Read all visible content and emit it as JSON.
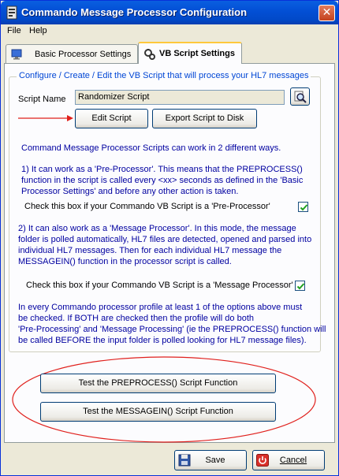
{
  "window": {
    "title": "Commando Message Processor Configuration",
    "close_glyph": "✕"
  },
  "menu": {
    "items": [
      "File",
      "Help"
    ]
  },
  "tabs": [
    {
      "label": "Basic Processor Settings",
      "icon": "monitor-icon",
      "active": false
    },
    {
      "label": "VB Script Settings",
      "icon": "script-icon",
      "active": true
    }
  ],
  "group": {
    "legend": "Configure / Create / Edit the VB Script that will process your HL7 messages",
    "script_name_label": "Script Name",
    "script_name_value": "Randomizer Script",
    "browse_icon": "magnifier-icon",
    "edit_button": "Edit Script",
    "export_button": "Export Script to Disk",
    "intro": "Command Message Processor Scripts can work in 2 different ways.",
    "pre_desc": [
      "1) It can work as a 'Pre-Processor'. This means that the PREPROCESS()",
      "function in the script is called every <xx> seconds as defined in the 'Basic",
      "Processor Settings' and before any other action is taken."
    ],
    "pre_check_label": "Check this box if your Commando VB Script is a 'Pre-Processor'",
    "pre_checked": true,
    "msg_desc": [
      "2) It can also work as a 'Message Processor'.  In this mode, the message",
      "folder is polled automatically, HL7 files are detected, opened and parsed into",
      "individual HL7 messages.  Then for each individual HL7 message the",
      "MESSAGEIN() function in the processor script is called."
    ],
    "msg_check_label": "Check this box if your Commando VB Script is a 'Message Processor'",
    "msg_checked": true,
    "note": [
      "In every Commando processor profile at least 1 of the options above must",
      "be checked.  If BOTH are checked then the profile will do both",
      "'Pre-Processing' and 'Message Processing' (ie the PREPROCESS() function will",
      "be called BEFORE the input folder is polled looking for HL7 message files)."
    ]
  },
  "test": {
    "preprocess_button": "Test the PREPROCESS() Script Function",
    "messagein_button": "Test the MESSAGEIN() Script Function"
  },
  "footer": {
    "save_label": "Save",
    "cancel_label": "Cancel",
    "save_icon": "floppy-disk-icon",
    "cancel_icon": "power-icon"
  },
  "colors": {
    "annotation_red": "#e0201c",
    "text_blue": "#0000a0",
    "title_blue": "#0350d6"
  }
}
